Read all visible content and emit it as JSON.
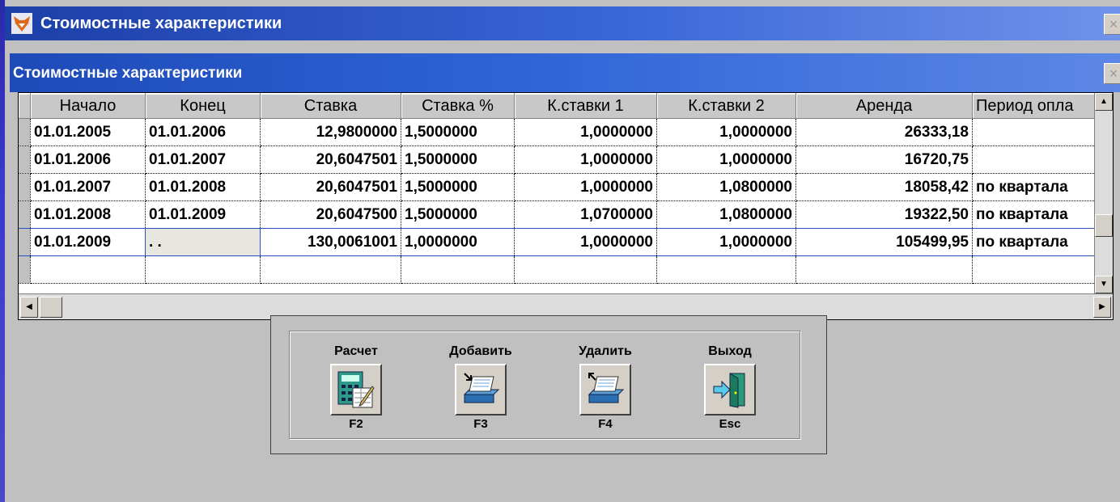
{
  "outer_window": {
    "title": "Стоимостные характеристики",
    "close": "×"
  },
  "inner_window": {
    "title": "Стоимостные характеристики",
    "close": "×"
  },
  "table": {
    "columns": [
      "Начало",
      "Конец",
      "Ставка",
      "Ставка %",
      "К.ставки 1",
      "К.ставки 2",
      "Аренда",
      "Период опла"
    ],
    "rows": [
      [
        "01.01.2005",
        "01.01.2006",
        "12,9800000",
        "1,5000000",
        "1,0000000",
        "1,0000000",
        "26333,18",
        ""
      ],
      [
        "01.01.2006",
        "01.01.2007",
        "20,6047501",
        "1,5000000",
        "1,0000000",
        "1,0000000",
        "16720,75",
        ""
      ],
      [
        "01.01.2007",
        "01.01.2008",
        "20,6047501",
        "1,5000000",
        "1,0000000",
        "1,0800000",
        "18058,42",
        "по квартала"
      ],
      [
        "01.01.2008",
        "01.01.2009",
        "20,6047500",
        "1,5000000",
        "1,0700000",
        "1,0800000",
        "19322,50",
        "по квартала"
      ],
      [
        "01.01.2009",
        "  .  .",
        "130,0061001",
        "1,0000000",
        "1,0000000",
        "1,0000000",
        "105499,95",
        "по квартала"
      ],
      [
        "",
        "",
        "",
        "",
        "",
        "",
        "",
        ""
      ]
    ],
    "current_row": 4,
    "editing_cell": 1
  },
  "buttons": [
    {
      "label": "Расчет",
      "key": "F2",
      "icon": "calculator-icon"
    },
    {
      "label": "Добавить",
      "key": "F3",
      "icon": "add-record-icon"
    },
    {
      "label": "Удалить",
      "key": "F4",
      "icon": "delete-record-icon"
    },
    {
      "label": "Выход",
      "key": "Esc",
      "icon": "exit-door-icon"
    }
  ],
  "colors": {
    "titlebar": "#1c3fa8",
    "selection": "#2a52be",
    "desktop": "#3b3bd0"
  }
}
